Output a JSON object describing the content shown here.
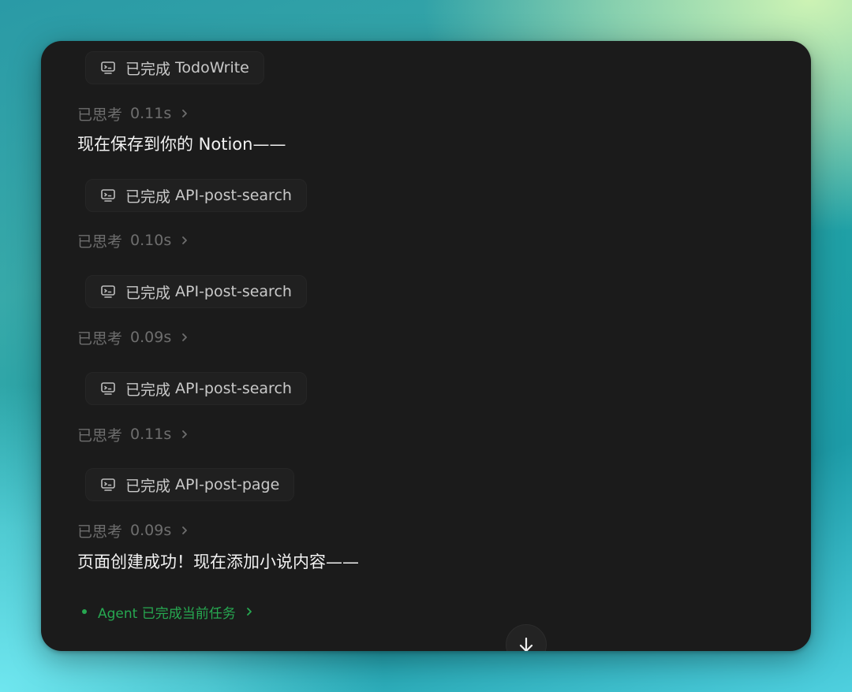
{
  "conversation": {
    "items": [
      {
        "kind": "tool",
        "status": "已完成",
        "name": "TodoWrite"
      },
      {
        "kind": "thought",
        "label": "已思考",
        "duration": "0.11s"
      },
      {
        "kind": "message",
        "text": "现在保存到你的 Notion——"
      },
      {
        "kind": "tool",
        "status": "已完成",
        "name": "API-post-search"
      },
      {
        "kind": "thought",
        "label": "已思考",
        "duration": "0.10s"
      },
      {
        "kind": "tool",
        "status": "已完成",
        "name": "API-post-search"
      },
      {
        "kind": "thought",
        "label": "已思考",
        "duration": "0.09s"
      },
      {
        "kind": "tool",
        "status": "已完成",
        "name": "API-post-search"
      },
      {
        "kind": "thought",
        "label": "已思考",
        "duration": "0.11s"
      },
      {
        "kind": "tool",
        "status": "已完成",
        "name": "API-post-page"
      },
      {
        "kind": "thought",
        "label": "已思考",
        "duration": "0.09s"
      },
      {
        "kind": "message",
        "text": "页面创建成功！现在添加小说内容——"
      }
    ]
  },
  "agent_status": {
    "text": "Agent 已完成当前任务",
    "color": "#27a851"
  },
  "icons": {
    "tool": "terminal-monitor-icon",
    "thought": "chevron-right-icon",
    "scroll": "arrow-down-icon"
  },
  "colors": {
    "panel": "#1b1b1b",
    "chip": "#202020",
    "muted_text": "#6e6e6e",
    "message_text": "#f2f2f2"
  }
}
